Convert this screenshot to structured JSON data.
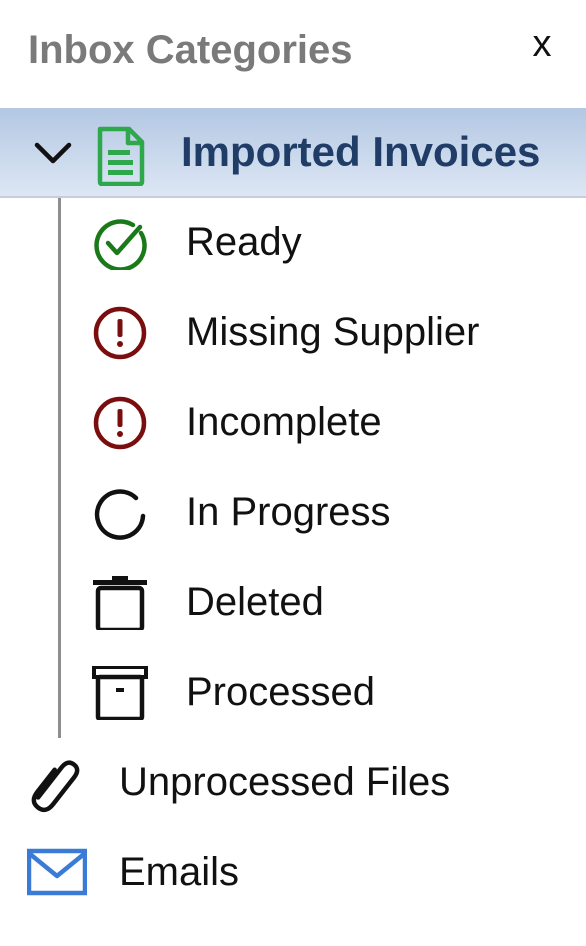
{
  "header": {
    "title": "Inbox Categories",
    "close_label": "x"
  },
  "section": {
    "label": "Imported Invoices",
    "icon": "document-icon",
    "expanded": true,
    "items": [
      {
        "label": "Ready",
        "icon": "check-circle-icon",
        "color": "#1a7a1a"
      },
      {
        "label": "Missing Supplier",
        "icon": "exclamation-circle-icon",
        "color": "#7a0e0e"
      },
      {
        "label": "Incomplete",
        "icon": "exclamation-circle-icon",
        "color": "#7a0e0e"
      },
      {
        "label": "In Progress",
        "icon": "progress-circle-icon",
        "color": "#111111"
      },
      {
        "label": "Deleted",
        "icon": "trash-icon",
        "color": "#111111"
      },
      {
        "label": "Processed",
        "icon": "archive-box-icon",
        "color": "#111111"
      }
    ]
  },
  "other_items": [
    {
      "label": "Unprocessed Files",
      "icon": "paperclip-icon",
      "color": "#111111"
    },
    {
      "label": "Emails",
      "icon": "envelope-icon",
      "color": "#3a7bd5"
    }
  ],
  "colors": {
    "header_text": "#7a7a7a",
    "section_text": "#1f3d66",
    "section_bg_top": "#b3c7e3",
    "section_bg_bottom": "#dde7f4",
    "doc_icon": "#2ea84a"
  }
}
